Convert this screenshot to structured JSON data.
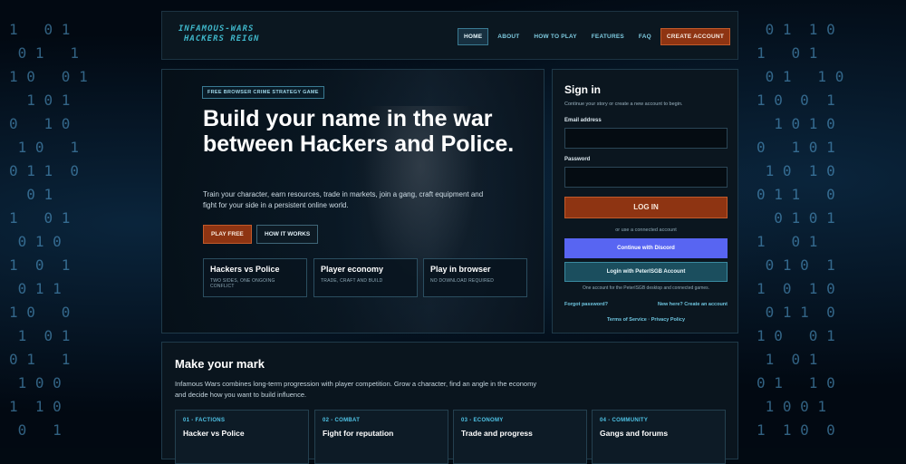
{
  "brand": {
    "logo_line1": "INFAMOUS-WARS",
    "logo_line2": "HACKERS REIGN"
  },
  "nav": {
    "home": "HOME",
    "about": "ABOUT",
    "how_to_play": "HOW TO PLAY",
    "features": "FEATURES",
    "faq": "FAQ",
    "create_account": "CREATE ACCOUNT"
  },
  "hero": {
    "badge": "FREE BROWSER CRIME STRATEGY GAME",
    "title": "Build your name in the war between Hackers and Police.",
    "lead": "Train your character, earn resources, trade in markets, join a gang, craft equipment and fight for your side in a persistent online world.",
    "play_free": "PLAY FREE",
    "how_it_works": "HOW IT WORKS",
    "features": [
      {
        "title": "Hackers vs Police",
        "sub": "TWO SIDES, ONE ONGOING CONFLICT"
      },
      {
        "title": "Player economy",
        "sub": "TRADE, CRAFT AND BUILD"
      },
      {
        "title": "Play in browser",
        "sub": "NO DOWNLOAD REQUIRED"
      }
    ]
  },
  "signin": {
    "title": "Sign in",
    "subtitle": "Continue your story or create a new account to begin.",
    "email_label": "Email address",
    "email_value": "",
    "password_label": "Password",
    "password_value": "",
    "login": "LOG IN",
    "or_text": "or use a connected account",
    "discord": "Continue with Discord",
    "pgb": "Login with PeterISGB Account",
    "note": "One account for the PeterISGB desktop and connected games.",
    "forgot": "Forgot password?",
    "new_here": "New here? Create an account",
    "legal": "Terms of Service · Privacy Policy"
  },
  "mark": {
    "title": "Make your mark",
    "text": "Infamous Wars combines long-term progression with player competition. Grow a character, find an angle in the economy and decide how you want to build influence.",
    "cards": [
      {
        "kicker": "01 - FACTIONS",
        "title": "Hacker vs Police",
        "desc": ""
      },
      {
        "kicker": "02 - COMBAT",
        "title": "Fight for reputation",
        "desc": ""
      },
      {
        "kicker": "03 - ECONOMY",
        "title": "Trade and progress",
        "desc": ""
      },
      {
        "kicker": "04 - COMMUNITY",
        "title": "Gangs and forums",
        "desc": ""
      }
    ]
  },
  "colors": {
    "accent": "#8e3412",
    "discord": "#5865f2",
    "cyan": "#4fc3e6"
  }
}
